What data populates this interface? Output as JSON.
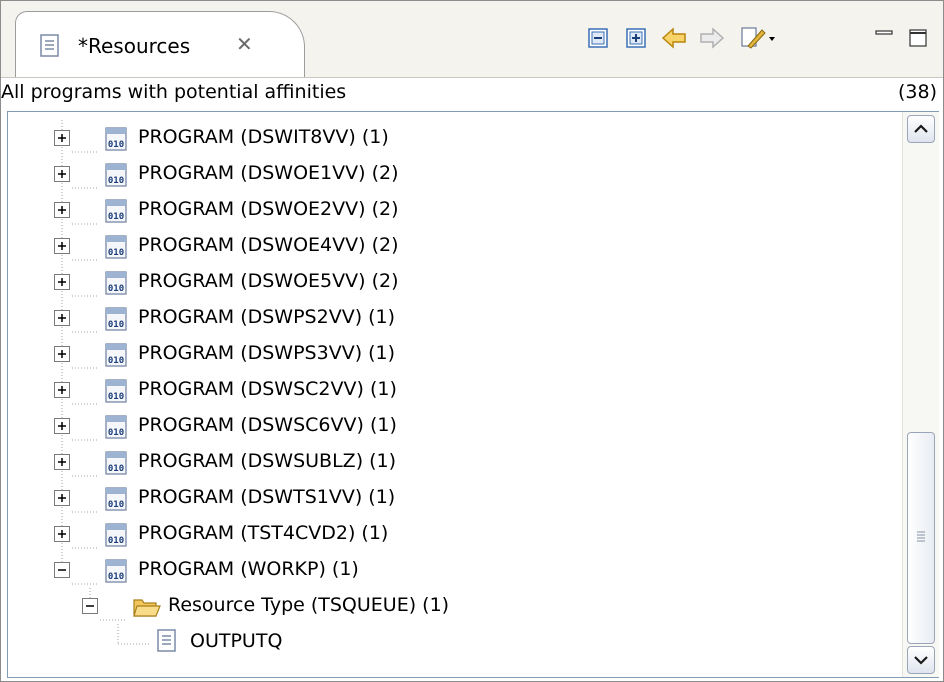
{
  "view": {
    "tab_label": "*Resources",
    "tab_close": "✕",
    "subtitle": "All programs with potential affinities",
    "count": "(38)"
  },
  "toolbar": {
    "buttons": [
      "collapse-all-icon",
      "expand-all-icon",
      "back-arrow-icon",
      "forward-arrow-icon",
      "view-menu-icon",
      "minimize-icon",
      "maximize-icon"
    ]
  },
  "tree": {
    "programs": [
      {
        "label": "PROGRAM (DSWIT8VV)  (1)"
      },
      {
        "label": "PROGRAM (DSWOE1VV)  (2)"
      },
      {
        "label": "PROGRAM (DSWOE2VV)  (2)"
      },
      {
        "label": "PROGRAM (DSWOE4VV)  (2)"
      },
      {
        "label": "PROGRAM (DSWOE5VV)  (2)"
      },
      {
        "label": "PROGRAM (DSWPS2VV)  (1)"
      },
      {
        "label": "PROGRAM (DSWPS3VV)  (1)"
      },
      {
        "label": "PROGRAM (DSWSC2VV)  (1)"
      },
      {
        "label": "PROGRAM (DSWSC6VV)  (1)"
      },
      {
        "label": "PROGRAM (DSWSUBLZ)  (1)"
      },
      {
        "label": "PROGRAM (DSWTS1VV)  (1)"
      },
      {
        "label": "PROGRAM (TST4CVD2)  (1)"
      },
      {
        "label": "PROGRAM (WORKP)  (1)"
      }
    ],
    "resource_type": {
      "label": "Resource Type (TSQUEUE)  (1)"
    },
    "leaf": {
      "label": "OUTPUTQ"
    }
  }
}
